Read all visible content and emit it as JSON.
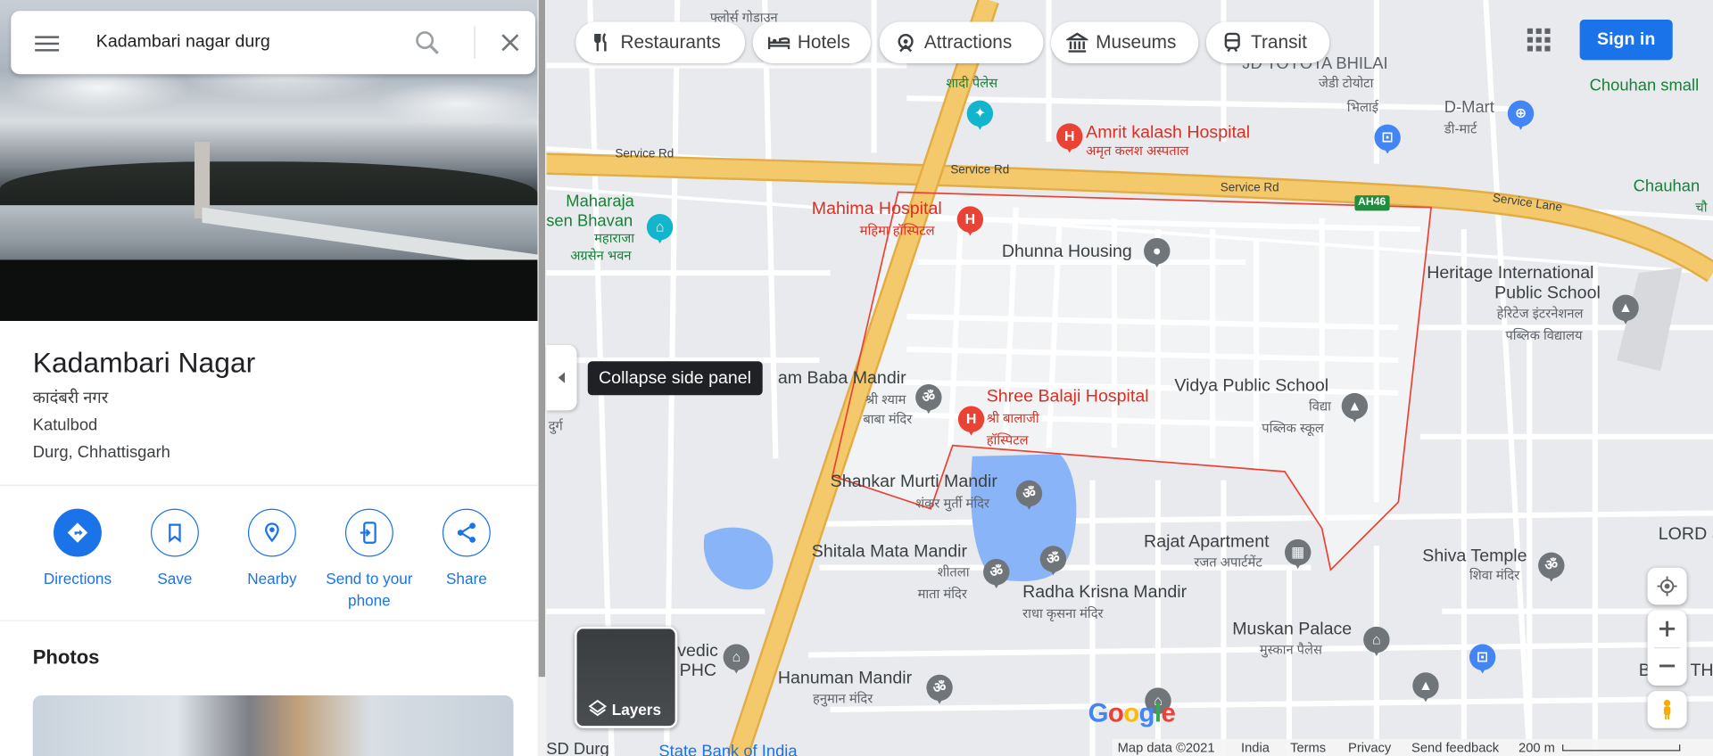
{
  "search": {
    "query": "Kadambari nagar durg"
  },
  "place": {
    "name": "Kadambari Nagar",
    "name_hindi": "कादंबरी नगर",
    "area": "Katulbod",
    "city": "Durg, Chhattisgarh"
  },
  "actions": [
    {
      "label": "Directions",
      "icon": "directions-icon"
    },
    {
      "label": "Save",
      "icon": "bookmark-icon"
    },
    {
      "label": "Nearby",
      "icon": "nearby-icon"
    },
    {
      "label": "Send to your phone",
      "icon": "phone-icon"
    },
    {
      "label": "Share",
      "icon": "share-icon"
    }
  ],
  "photos": {
    "title": "Photos"
  },
  "chips": [
    {
      "label": "Restaurants",
      "icon": "restaurant-icon"
    },
    {
      "label": "Hotels",
      "icon": "hotel-icon"
    },
    {
      "label": "Attractions",
      "icon": "attraction-icon"
    },
    {
      "label": "Museums",
      "icon": "museum-icon"
    },
    {
      "label": "Transit",
      "icon": "transit-icon"
    }
  ],
  "header": {
    "signin_label": "Sign in"
  },
  "tooltip": {
    "collapse": "Collapse side panel"
  },
  "layers": {
    "label": "Layers"
  },
  "map": {
    "labels": {
      "toyota": "JD TOYOTA BHILAI",
      "toyota_hi1": "जेडी टोयोटा",
      "toyota_hi2": "भिलाई",
      "chauhan_small": "Chouhan small",
      "dmart": "D-Mart",
      "dmart_hi": "डी-मार्ट",
      "amrit": "Amrit kalash Hospital",
      "amrit_hi": "अमृत कलश अस्पताल",
      "shadi_hi": "शादी पैलेस",
      "flores_hi": "फ्लोर्स गोडाउन",
      "service_rd1": "Service Rd",
      "service_rd2": "Service Rd",
      "service_rd3": "Service Rd",
      "service_lane": "Service Lane",
      "ah46": "AH46",
      "chauhan2": "Chauhan",
      "chauhan2_hi": "चौ",
      "maharaja1": "Maharaja",
      "maharaja2": "sen Bhavan",
      "maharaja_hi1": "महाराजा",
      "maharaja_hi2": "अग्रसेन भवन",
      "mahima": "Mahima Hospital",
      "mahima_hi": "महिमा हॉस्पिटल",
      "dhunna": "Dhunna Housing",
      "heritage1": "Heritage International",
      "heritage2": "Public School",
      "heritage_hi1": "हेरिटेज इंटरनेशनल",
      "heritage_hi2": "पब्लिक विद्यालय",
      "baba": "am Baba Mandir",
      "baba_hi1": "श्री श्याम",
      "baba_hi2": "बाबा मंदिर",
      "durg_hi": "दुर्ग",
      "shree_balaji": "Shree Balaji Hospital",
      "balaji_hi1": "श्री बालाजी",
      "balaji_hi2": "हॉस्पिटल",
      "vidya": "Vidya Public School",
      "vidya_hi1": "विद्या",
      "vidya_hi2": "पब्लिक स्कूल",
      "shankar": "Shankar Murti Mandir",
      "shankar_hi": "शंकर मुर्ती मंदिर",
      "shitala": "Shitala Mata Mandir",
      "shitala_hi1": "शीतला",
      "shitala_hi2": "माता मंदिर",
      "rajat": "Rajat Apartment",
      "rajat_hi": "रजत अपार्टमेंट",
      "shiva": "Shiva Temple",
      "shiva_hi": "शिवा मंदिर",
      "lord_shiv": "LORD SHIV",
      "radha": "Radha Krisna Mandir",
      "radha_hi": "राधा कृसना मंदिर",
      "muskan": "Muskan Palace",
      "muskan_hi": "मुस्कान पैलेस",
      "vedic": "vedic",
      "phc": "PHC",
      "hanuman": "Hanuman Mandir",
      "hanuman_hi": "हनुमान मंदिर",
      "bhol": "BHOL TH",
      "sd_durg": "SD Durg",
      "sbi": "State Bank of India"
    },
    "colors": {
      "land": "#e8eaed",
      "highway": "#f4c96b",
      "highway_edge": "#e3ad45",
      "water": "#8ab4f8",
      "boundary": "#ea4335"
    }
  },
  "footer": {
    "logo": "Google",
    "map_data": "Map data ©2021",
    "country": "India",
    "terms": "Terms",
    "privacy": "Privacy",
    "feedback": "Send feedback",
    "scale": "200 m"
  }
}
